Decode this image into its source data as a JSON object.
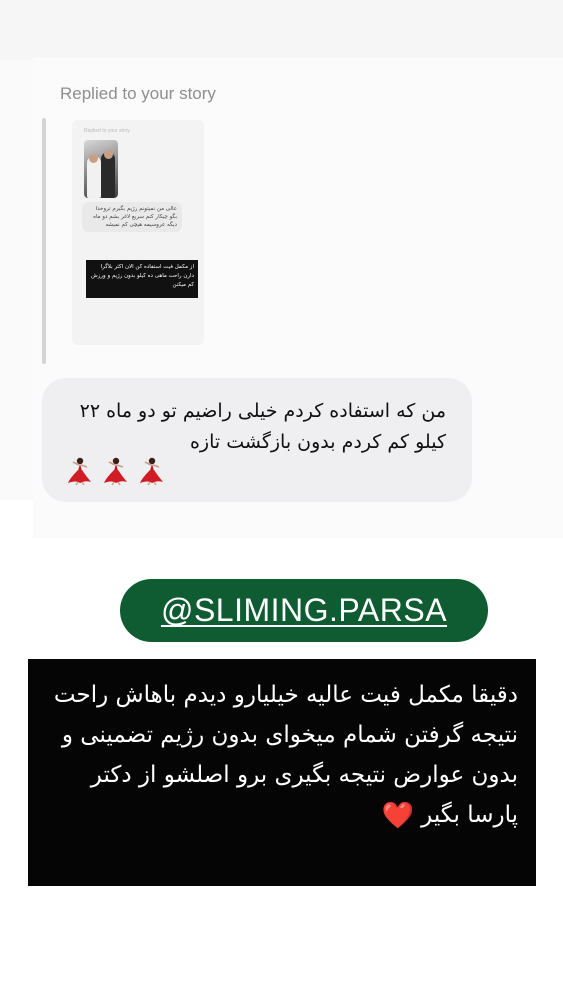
{
  "story_reply": {
    "label": "Replied to your story",
    "thumbnail": {
      "caption": "Replied to your story",
      "bubble_text": "عالی من نمیتونم رژیم بگیرم تروخدا بگو چیکار کنم سریع لاغر بشم دو ماه دیگه عروسیمه هیچی کم نمیشه",
      "black_text": "از مکمل فیت استفاده کن الان اکثر بلاگرا دارن راحت ماهی ده کیلو بدون رژیم و ورزش کم میکنن"
    }
  },
  "message": {
    "text": "من که استفاده کردم  خیلی راضیم تو دو ماه ۲۲ کیلو کم کردم بدون بازگشت  تازه",
    "emoji_icon": "dancer-emoji",
    "emoji_count": 3
  },
  "handle": {
    "text": "@SLIMING.PARSA",
    "color": "#0f5c32"
  },
  "promo": {
    "text": "دقیقا مکمل فیت عالیه خیلیارو دیدم باهاش راحت نتیجه گرفتن شمام میخوای بدون رژیم تضمینی و بدون عوارض نتیجه بگیری برو اصلشو از دکتر پارسا بگیر",
    "heart": "❤️",
    "heart_icon": "heart-icon"
  }
}
